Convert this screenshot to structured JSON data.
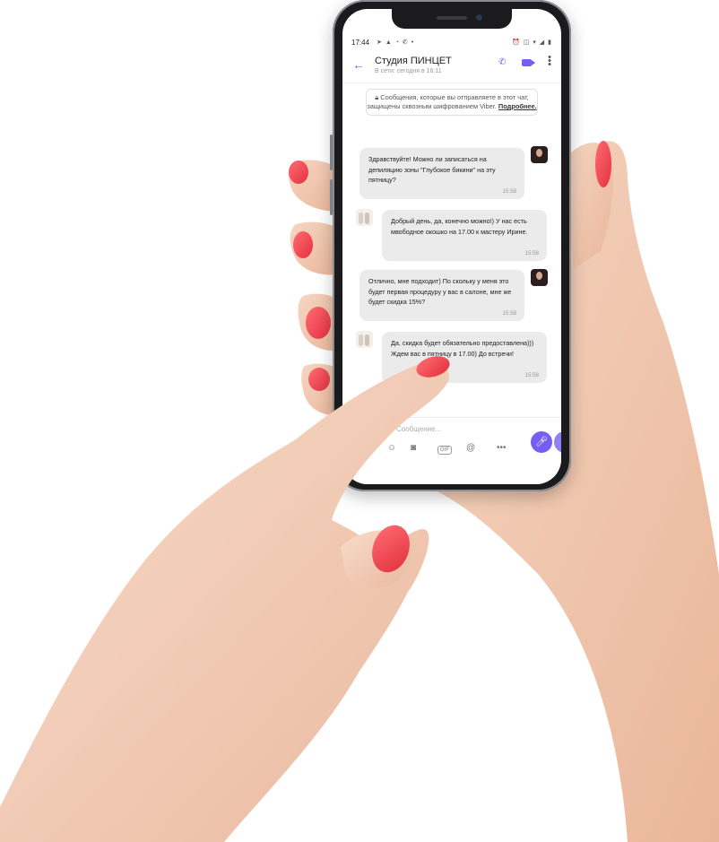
{
  "status_bar": {
    "time": "17:44",
    "left_icons": [
      "telegram-icon",
      "navigation-icon",
      "sync-icon",
      "viber-icon",
      "dot-icon"
    ],
    "right_icons": [
      "alarm-icon",
      "vibrate-icon",
      "wifi-icon",
      "signal-icon",
      "battery-icon"
    ]
  },
  "header": {
    "title": "Студия ПИНЦЕТ",
    "subtitle": "В сети: сегодня в 16:11",
    "back_icon": "arrow-left-icon",
    "call_icon": "phone-icon",
    "video_icon": "video-icon",
    "menu_icon": "more-vertical-icon"
  },
  "notice": {
    "text": "Сообщения, которые вы отправляете в этот чат, защищены сквозным шифрованием Viber.",
    "link": "Подробнее."
  },
  "messages": [
    {
      "direction": "outgoing",
      "text": "Здравствуйте! Можно ли записаться на депиляцию зоны \"Глубокое бикини\" на эту пятницу?",
      "time": "15:58"
    },
    {
      "direction": "incoming",
      "text": "Добрый день, да, конечно можно!) У нас есть мвободное окошко на 17.00 к мастеру Ирине.",
      "time": "15:58"
    },
    {
      "direction": "outgoing",
      "text": "Отлично, мне подходит) По скольку у меня это будет первая процедуру у вас в салоне, мне же будет скидка 15%?",
      "time": "15:58"
    },
    {
      "direction": "incoming",
      "text": "Да, скидка будет обязательно предоставлена))) Ждем вас в пятницу в 17.00) До встречи!",
      "time": "15:58"
    }
  ],
  "composer": {
    "placeholder": "Сообщение...",
    "toolbar": [
      "sticker-icon",
      "camera-icon",
      "gif-icon",
      "mention-icon",
      "more-horizontal-icon"
    ],
    "gif_label": "GIF",
    "send_icon": "microphone-icon"
  },
  "colors": {
    "accent": "#7360f2",
    "nail": "#f0424e",
    "skin": "#f3cbb2",
    "bubble": "#ebebeb"
  }
}
